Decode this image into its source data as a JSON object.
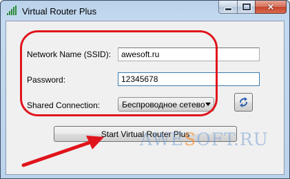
{
  "window": {
    "title": "Virtual Router Plus",
    "close_glyph": "×"
  },
  "form": {
    "ssid_label": "Network Name (SSID):",
    "ssid_value": "awesoft.ru",
    "password_label": "Password:",
    "password_value": "12345678",
    "shared_label": "Shared Connection:",
    "shared_value": "Беспроводное сетево"
  },
  "buttons": {
    "start_label": "Start Virtual Router Plus"
  },
  "watermark": {
    "part1": "AWE",
    "part2": "S",
    "part3": "OFT.RU"
  },
  "colors": {
    "highlight_outline": "#e0141b",
    "arrow": "#e0141b",
    "titlebar": "#c4daf0"
  },
  "icons": {
    "app": "signal-bars-icon",
    "refresh": "refresh-icon",
    "dropdown": "chevron-down-icon"
  }
}
